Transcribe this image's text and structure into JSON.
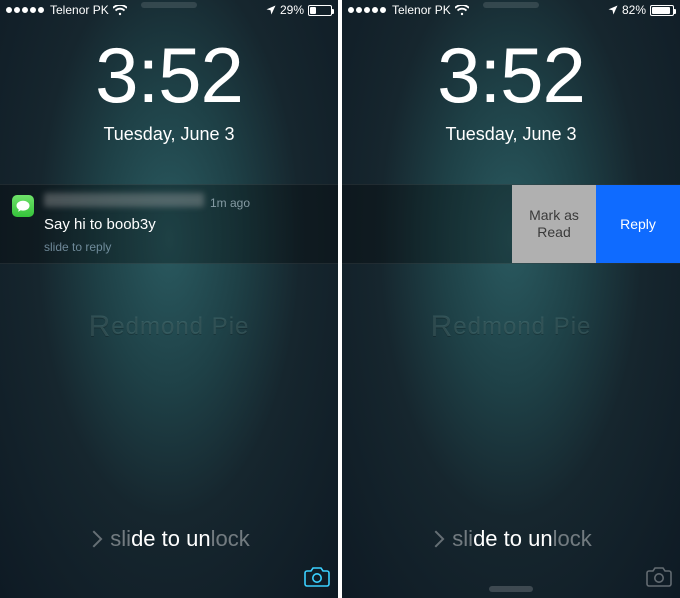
{
  "left": {
    "status": {
      "signal_filled": 5,
      "signal_total": 5,
      "carrier": "Telenor PK",
      "battery_pct": "29%",
      "battery_fill": 29
    },
    "time": "3:52",
    "date": "Tuesday, June 3",
    "notification": {
      "app": "Messages",
      "timestamp": "1m ago",
      "message": "Say hi to boob3y",
      "hint": "slide to reply"
    },
    "watermark": "Redmond Pie",
    "unlock_prefix": "sli",
    "unlock_highlight": "de to un",
    "unlock_suffix": "lock"
  },
  "right": {
    "status": {
      "signal_filled": 5,
      "signal_total": 5,
      "carrier": "Telenor PK",
      "battery_pct": "82%",
      "battery_fill": 82
    },
    "time": "3:52",
    "date": "Tuesday, June 3",
    "actions": {
      "mark_read": "Mark as Read",
      "reply": "Reply"
    },
    "watermark": "Redmond Pie",
    "unlock_prefix": "sli",
    "unlock_highlight": "de to un",
    "unlock_suffix": "lock"
  }
}
